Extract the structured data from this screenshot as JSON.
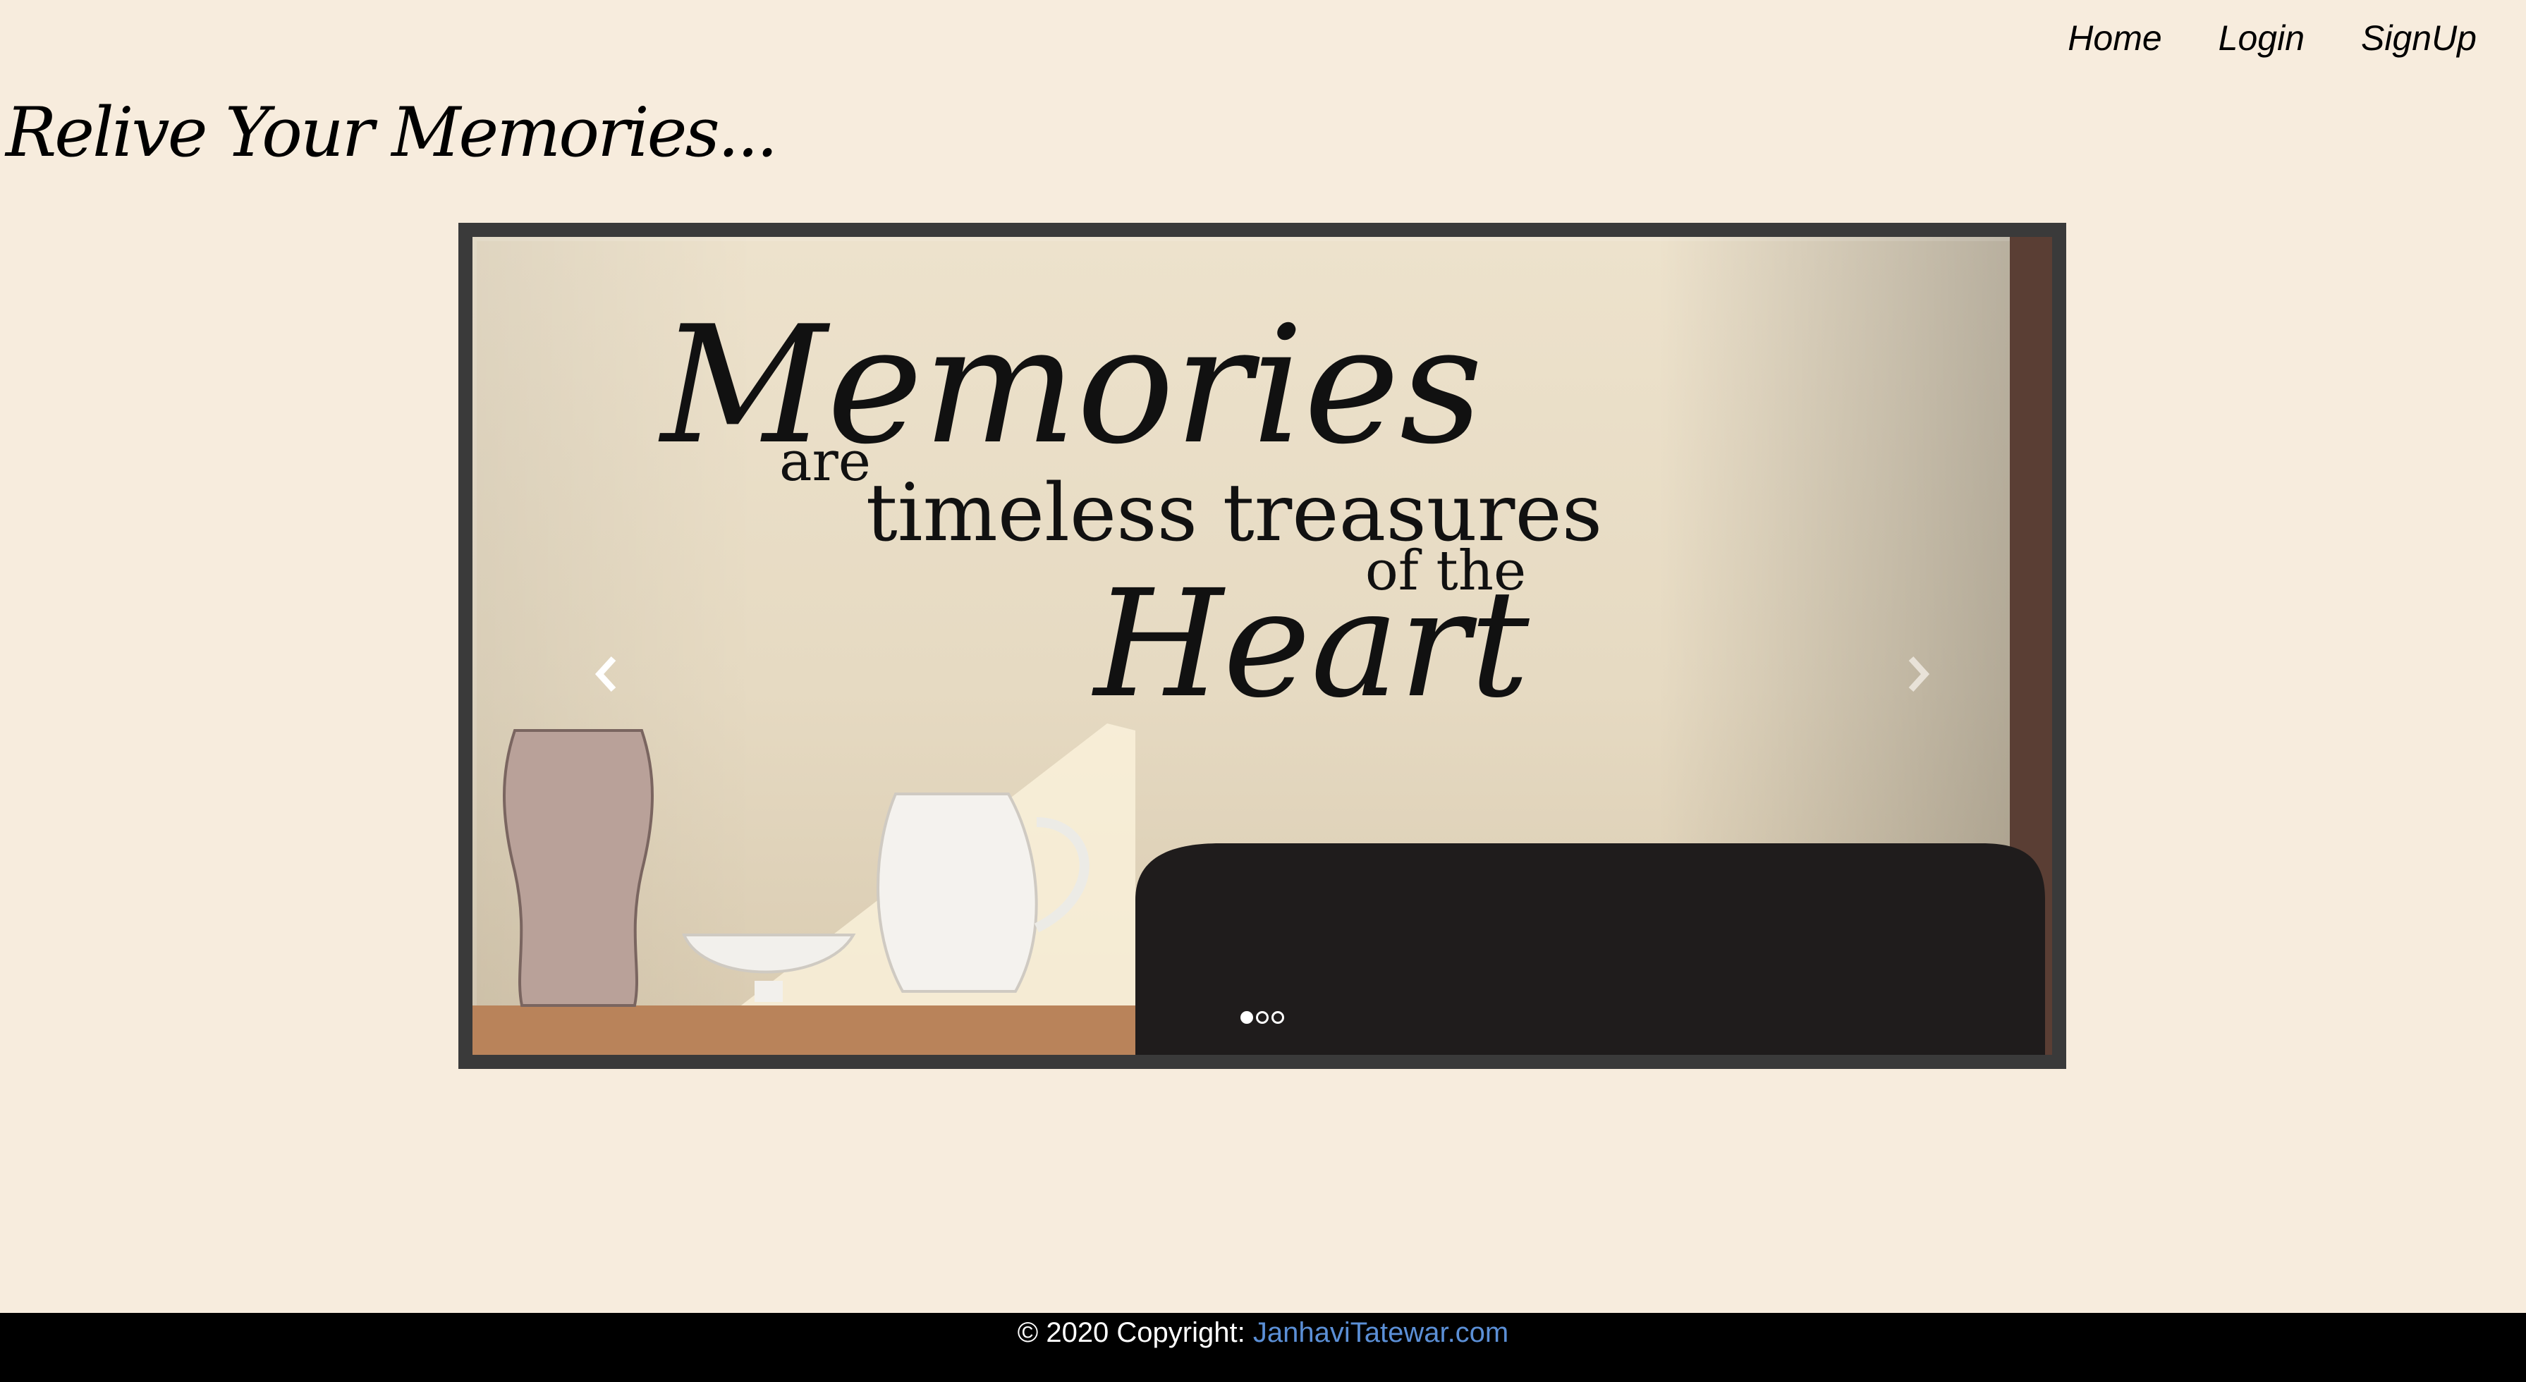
{
  "nav": {
    "items": [
      {
        "label": "Home"
      },
      {
        "label": "Login"
      },
      {
        "label": "SignUp"
      }
    ]
  },
  "heading": "Relive Your Memories...",
  "carousel": {
    "slide_text": {
      "line1": "Memories",
      "line2": "are",
      "line3": "timeless treasures",
      "line4": "of the",
      "line5": "Heart"
    },
    "slide_count": 3,
    "active_index": 0,
    "prev_icon": "chevron-left-icon",
    "next_icon": "chevron-right-icon"
  },
  "footer": {
    "copyright": "© 2020 Copyright: ",
    "link_text": "JanhaviTatewar.com"
  },
  "colors": {
    "background": "#f7ecdd",
    "footer_bg": "#000000",
    "footer_link": "#5b8fd6"
  }
}
